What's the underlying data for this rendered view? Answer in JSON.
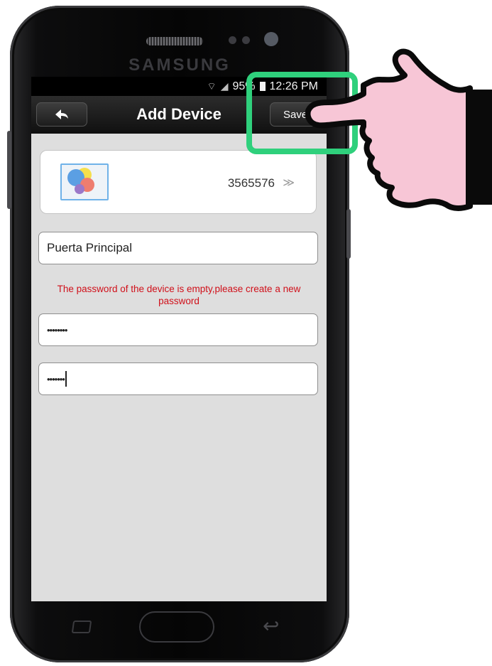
{
  "phone": {
    "brand": "SAMSUNG"
  },
  "status_bar": {
    "battery_percent": "95%",
    "time": "12:26 PM"
  },
  "header": {
    "back_icon": "back-arrow-icon",
    "title": "Add Device",
    "save_label": "Save"
  },
  "device": {
    "id": "3565576",
    "chevron": "≫"
  },
  "form": {
    "name_value": "Puerta Principal",
    "warning": "The password of the device is empty,please create a new password",
    "password_mask": "••••••••",
    "confirm_mask": "•••••••"
  },
  "colors": {
    "highlight": "#2fd07c",
    "warning_text": "#d0101a",
    "hand_fill": "#f7c6d6"
  }
}
